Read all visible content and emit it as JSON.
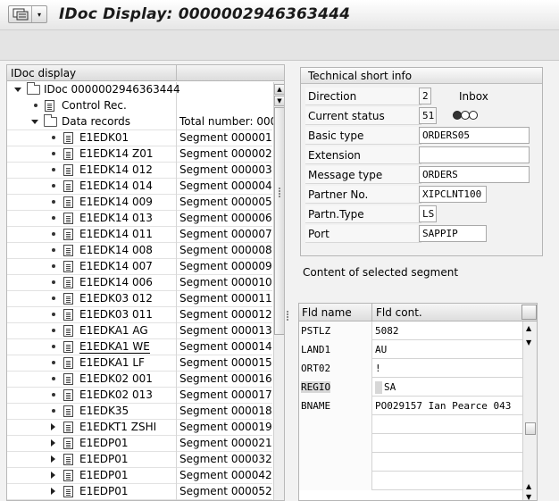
{
  "window": {
    "title": "IDoc Display: 0000002946363444"
  },
  "tree": {
    "header": "IDoc display",
    "root": "IDoc 0000002946363444",
    "control": "Control Rec.",
    "data_records": "Data records",
    "total": "Total number: 000",
    "items": [
      {
        "label": "E1EDK01",
        "seg": "Segment 000001",
        "expander": "bullet"
      },
      {
        "label": "E1EDK14 Z01",
        "seg": "Segment 000002",
        "expander": "bullet"
      },
      {
        "label": "E1EDK14 012",
        "seg": "Segment 000003",
        "expander": "bullet"
      },
      {
        "label": "E1EDK14 014",
        "seg": "Segment 000004",
        "expander": "bullet"
      },
      {
        "label": "E1EDK14 009",
        "seg": "Segment 000005",
        "expander": "bullet"
      },
      {
        "label": "E1EDK14 013",
        "seg": "Segment 000006",
        "expander": "bullet"
      },
      {
        "label": "E1EDK14 011",
        "seg": "Segment 000007",
        "expander": "bullet"
      },
      {
        "label": "E1EDK14 008",
        "seg": "Segment 000008",
        "expander": "bullet"
      },
      {
        "label": "E1EDK14 007",
        "seg": "Segment 000009",
        "expander": "bullet"
      },
      {
        "label": "E1EDK14 006",
        "seg": "Segment 000010",
        "expander": "bullet"
      },
      {
        "label": "E1EDK03 012",
        "seg": "Segment 000011",
        "expander": "bullet"
      },
      {
        "label": "E1EDK03 011",
        "seg": "Segment 000012",
        "expander": "bullet"
      },
      {
        "label": "E1EDKA1 AG",
        "seg": "Segment 000013",
        "expander": "bullet"
      },
      {
        "label": "E1EDKA1 WE",
        "seg": "Segment 000014",
        "expander": "bullet",
        "selected": true
      },
      {
        "label": "E1EDKA1 LF",
        "seg": "Segment 000015",
        "expander": "bullet"
      },
      {
        "label": "E1EDK02 001",
        "seg": "Segment 000016",
        "expander": "bullet"
      },
      {
        "label": "E1EDK02 013",
        "seg": "Segment 000017",
        "expander": "bullet"
      },
      {
        "label": "E1EDK35",
        "seg": "Segment 000018",
        "expander": "bullet"
      },
      {
        "label": "E1EDKT1 ZSHI",
        "seg": "Segment 000019",
        "expander": "triangle"
      },
      {
        "label": "E1EDP01",
        "seg": "Segment 000021",
        "expander": "triangle"
      },
      {
        "label": "E1EDP01",
        "seg": "Segment 000032",
        "expander": "triangle"
      },
      {
        "label": "E1EDP01",
        "seg": "Segment 000042",
        "expander": "triangle"
      },
      {
        "label": "E1EDP01",
        "seg": "Segment 000052",
        "expander": "triangle"
      }
    ]
  },
  "tech": {
    "header": "Technical short info",
    "direction_label": "Direction",
    "direction_value": "2",
    "direction_text": "Inbox",
    "status_label": "Current status",
    "status_value": "51",
    "status_icon": "traffic-light-red",
    "basic_type_label": "Basic type",
    "basic_type_value": "ORDERS05",
    "extension_label": "Extension",
    "extension_value": "",
    "message_type_label": "Message type",
    "message_type_value": "ORDERS",
    "partner_no_label": "Partner No.",
    "partner_no_value": "XIPCLNT100",
    "partn_type_label": "Partn.Type",
    "partn_type_value": "LS",
    "port_label": "Port",
    "port_value": "SAPPIP"
  },
  "segment": {
    "label": "Content of selected segment",
    "col_name": "Fld name",
    "col_cont": "Fld cont.",
    "rows": [
      {
        "name": "PSTLZ",
        "value": "5082"
      },
      {
        "name": "LAND1",
        "value": "AU"
      },
      {
        "name": "ORT02",
        "value": "!"
      },
      {
        "name": "REGIO",
        "value": "SA",
        "highlight": true
      },
      {
        "name": "BNAME",
        "value": "PO029157 Ian Pearce 043"
      }
    ]
  },
  "colors": {
    "background": "#f2f2f2",
    "panel": "#ffffff",
    "border": "#b5b5b5"
  }
}
